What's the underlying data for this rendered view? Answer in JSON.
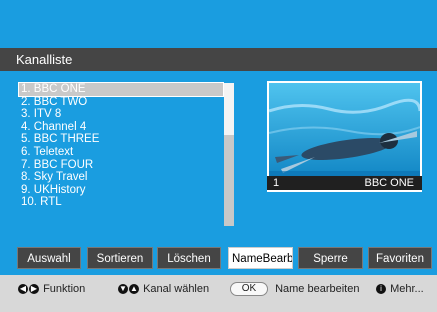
{
  "header": {
    "title": "Kanalliste"
  },
  "channels": [
    "1. BBC ONE",
    "2. BBC TWO",
    "3. ITV 8",
    "4. Channel 4",
    "5. BBC THREE",
    "6. Teletext",
    "7. BBC FOUR",
    "8. Sky Travel",
    "9. UKHistory",
    "10. RTL"
  ],
  "preview": {
    "number": "1",
    "name": "BBC ONE"
  },
  "buttons": {
    "auswahl": "Auswahl",
    "sortieren": "Sortieren",
    "loeschen": "Löschen",
    "namebearb": "NameBearb",
    "sperre": "Sperre",
    "favoriten": "Favoriten"
  },
  "footer": {
    "funktion": "Funktion",
    "kanal": "Kanal wählen",
    "ok": "OK",
    "name": "Name bearbeiten",
    "info": "i",
    "mehr": "Mehr..."
  },
  "colors": {
    "accent": "#1a9de0",
    "bar": "#454545"
  }
}
